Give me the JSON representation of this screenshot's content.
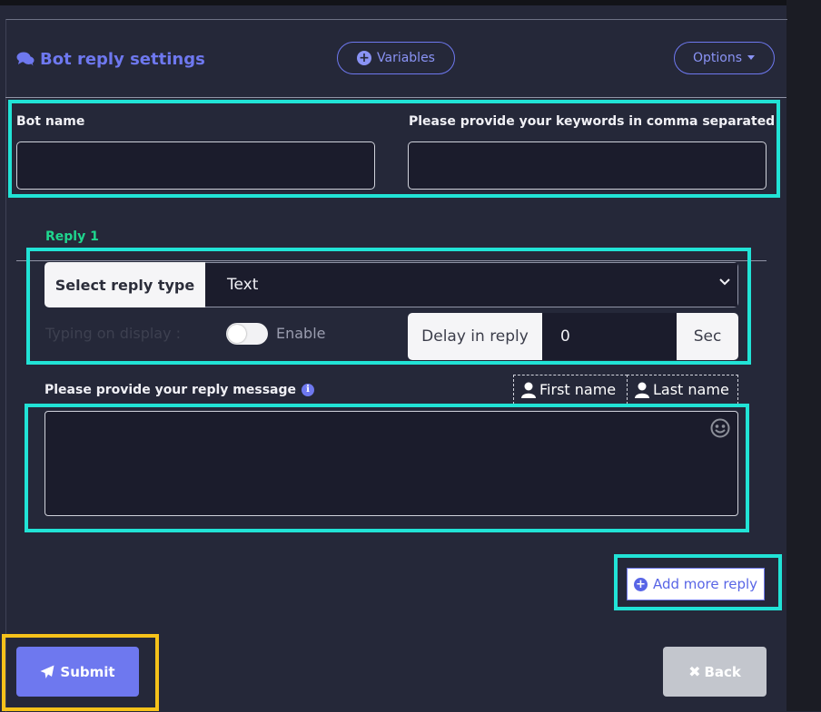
{
  "header": {
    "title": "Bot reply settings",
    "variables_label": "Variables",
    "options_label": "Options"
  },
  "form": {
    "bot_name_label": "Bot name",
    "bot_name_value": "",
    "keywords_label": "Please provide your keywords in comma separated",
    "keywords_value": ""
  },
  "reply": {
    "title": "Reply 1",
    "reply_type_label": "Select reply type",
    "reply_type_value": "Text",
    "typing_label": "Typing on display :",
    "toggle_label": "Enable",
    "delay_label": "Delay in reply",
    "delay_value": "0",
    "delay_unit": "Sec",
    "message_label": "Please provide your reply message",
    "first_name_label": "First name",
    "last_name_label": "Last name",
    "message_value": ""
  },
  "actions": {
    "add_more_label": "Add more reply",
    "submit_label": "Submit",
    "back_label": "Back"
  },
  "colors": {
    "accent": "#6e78ef",
    "highlight_cyan": "#21e3d6",
    "highlight_yellow": "#f6c21a",
    "reply_green": "#1fd68e",
    "background": "#252839"
  }
}
